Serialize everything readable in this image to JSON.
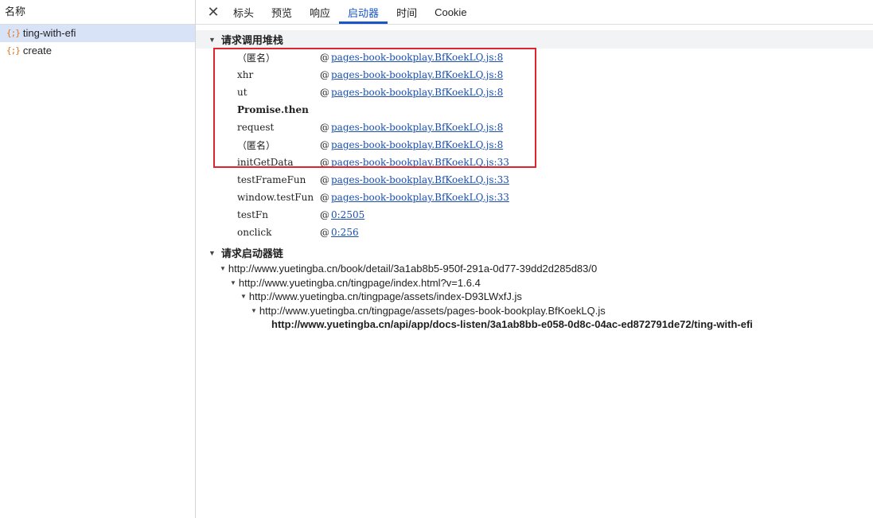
{
  "left": {
    "header": "名称",
    "items": [
      {
        "icon": "{;}",
        "label": "ting-with-efi",
        "selected": true
      },
      {
        "icon": "{;}",
        "label": "create",
        "selected": false
      }
    ]
  },
  "tabs": [
    "标头",
    "预览",
    "响应",
    "启动器",
    "时间",
    "Cookie"
  ],
  "active_tab": "启动器",
  "stack_section": {
    "title": "请求调用堆栈",
    "rows": [
      {
        "fn": "（匿名）",
        "at": "@",
        "loc": "pages-book-bookplay.BfKoekLQ.js:8"
      },
      {
        "fn": "xhr",
        "at": "@",
        "loc": "pages-book-bookplay.BfKoekLQ.js:8"
      },
      {
        "fn": "ut",
        "at": "@",
        "loc": "pages-book-bookplay.BfKoekLQ.js:8"
      },
      {
        "fn": "Promise.then",
        "at": "",
        "loc": ""
      },
      {
        "fn": "request",
        "at": "@",
        "loc": "pages-book-bookplay.BfKoekLQ.js:8"
      },
      {
        "fn": "（匿名）",
        "at": "@",
        "loc": "pages-book-bookplay.BfKoekLQ.js:8"
      },
      {
        "fn": "initGetData",
        "at": "@",
        "loc": "pages-book-bookplay.BfKoekLQ.js:33"
      },
      {
        "fn": "testFrameFun",
        "at": "@",
        "loc": "pages-book-bookplay.BfKoekLQ.js:33"
      },
      {
        "fn": "window.testFun",
        "at": "@",
        "loc": "pages-book-bookplay.BfKoekLQ.js:33"
      },
      {
        "fn": "testFn",
        "at": "@",
        "loc": "0:2505"
      },
      {
        "fn": "onclick",
        "at": "@",
        "loc": "0:256"
      }
    ]
  },
  "chain_section": {
    "title": "请求启动器链",
    "rows": [
      {
        "url": "http://www.yuetingba.cn/book/detail/3a1ab8b5-950f-291a-0d77-39dd2d285d83/0",
        "depth": 0
      },
      {
        "url": "http://www.yuetingba.cn/tingpage/index.html?v=1.6.4",
        "depth": 1
      },
      {
        "url": "http://www.yuetingba.cn/tingpage/assets/index-D93LWxfJ.js",
        "depth": 2
      },
      {
        "url": "http://www.yuetingba.cn/tingpage/assets/pages-book-bookplay.BfKoekLQ.js",
        "depth": 3
      },
      {
        "url": "http://www.yuetingba.cn/api/app/docs-listen/3a1ab8bb-e058-0d8c-04ac-ed872791de72/ting-with-efi",
        "depth": 4
      }
    ]
  },
  "colors": {
    "accent": "#1a56c9",
    "highlight": "#e0242b",
    "link": "#1a4fb0"
  }
}
